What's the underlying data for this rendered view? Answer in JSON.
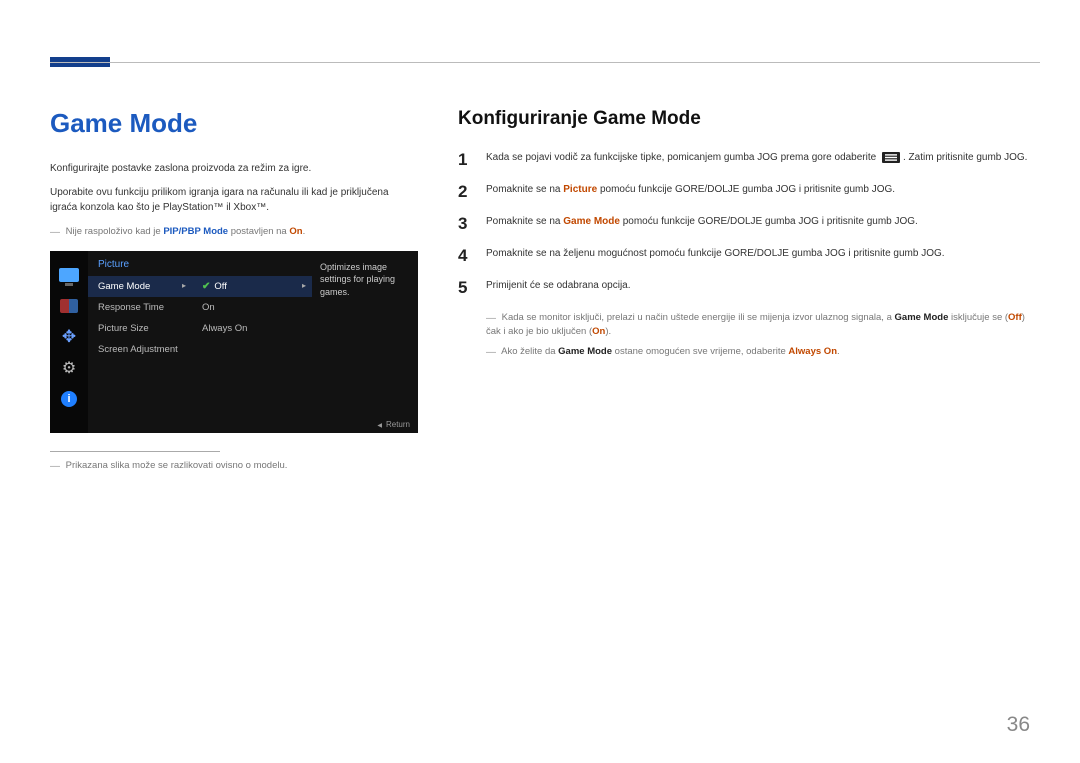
{
  "page_number": "36",
  "left": {
    "title": "Game Mode",
    "p1": "Konfigurirajte postavke zaslona proizvoda za režim za igre.",
    "p2": "Uporabite ovu funkciju prilikom igranja igara na računalu ili kad je priključena igraća konzola kao što je PlayStation™ il Xbox™.",
    "note_prefix": "―",
    "note_pre": "Nije raspoloživo kad je ",
    "note_mode": "PIP/PBP Mode",
    "note_mid": " postavljen na ",
    "note_on": "On",
    "note_end": ".",
    "caption": "Prikazana slika može se razlikovati ovisno o modelu."
  },
  "osd": {
    "header": "Picture",
    "menu": [
      "Game Mode",
      "Response Time",
      "Picture Size",
      "Screen Adjustment"
    ],
    "options": [
      "Off",
      "On",
      "Always On"
    ],
    "desc": "Optimizes image settings for playing games.",
    "return": "Return",
    "icon_names": [
      "monitor-icon",
      "pbp-icon",
      "move-icon",
      "gear-icon",
      "info-icon"
    ]
  },
  "right": {
    "title": "Konfiguriranje Game Mode",
    "steps": [
      {
        "num": "1",
        "pre": "Kada se pojavi vodič za funkcijske tipke, pomicanjem gumba JOG prema gore odaberite ",
        "post": ". Zatim pritisnite gumb JOG."
      },
      {
        "num": "2",
        "pre": "Pomaknite se na ",
        "kw": "Picture",
        "post": " pomoću funkcije GORE/DOLJE gumba JOG i pritisnite gumb JOG."
      },
      {
        "num": "3",
        "pre": "Pomaknite se na ",
        "kw": "Game Mode",
        "post": " pomoću funkcije GORE/DOLJE gumba JOG i pritisnite gumb JOG."
      },
      {
        "num": "4",
        "text": "Pomaknite se na željenu mogućnost pomoću funkcije GORE/DOLJE gumba JOG i pritisnite gumb JOG."
      },
      {
        "num": "5",
        "text": "Primijenit će se odabrana opcija."
      }
    ],
    "note1_pre": "Kada se monitor isključi, prelazi u način uštede energije ili se mijenja izvor ulaznog signala, a ",
    "note1_kw1": "Game Mode",
    "note1_mid": " isključuje se (",
    "note1_off": "Off",
    "note1_mid2": ") čak i ako je bio uključen (",
    "note1_on": "On",
    "note1_end": ").",
    "note2_pre": "Ako želite da ",
    "note2_kw": "Game Mode",
    "note2_mid": " ostane omogućen sve vrijeme, odaberite ",
    "note2_always": "Always On",
    "note2_end": "."
  }
}
